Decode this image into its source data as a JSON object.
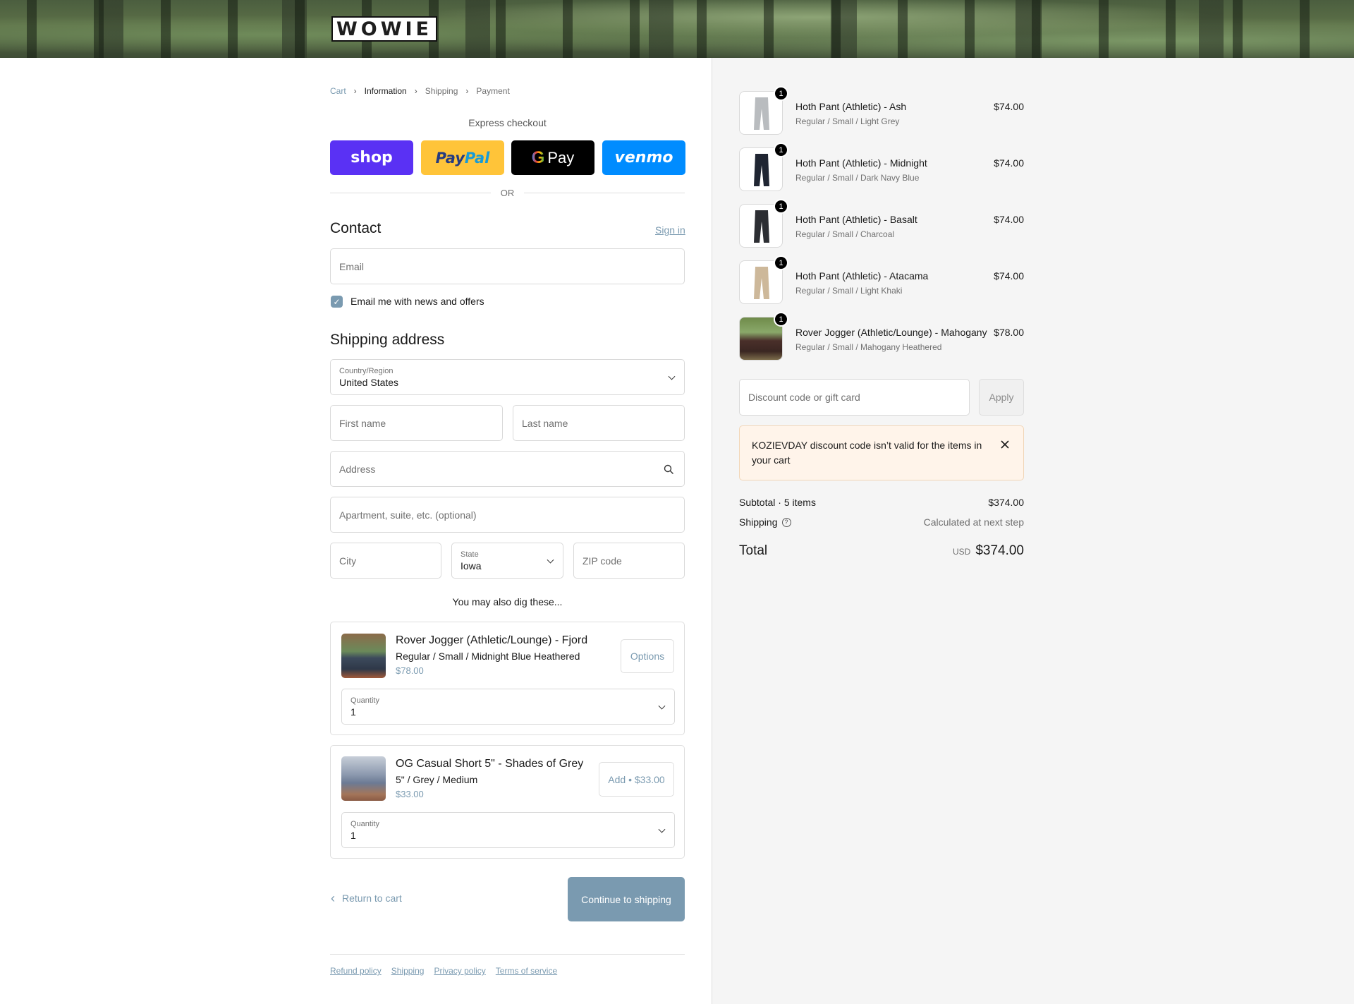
{
  "brand": {
    "logo_text": "WOWIE"
  },
  "breadcrumb": {
    "items": [
      "Cart",
      "Information",
      "Shipping",
      "Payment"
    ],
    "active_index": 1
  },
  "express": {
    "title": "Express checkout",
    "shop_label": "shop",
    "paypal_part1": "Pay",
    "paypal_part2": "Pal",
    "gpay_g": "G",
    "gpay_label": "Pay",
    "venmo_label": "venmo",
    "or_label": "OR"
  },
  "contact": {
    "heading": "Contact",
    "sign_in_label": "Sign in",
    "email_placeholder": "Email",
    "newsletter_label": "Email me with news and offers",
    "newsletter_checked": true
  },
  "shipping_address": {
    "heading": "Shipping address",
    "country_label": "Country/Region",
    "country_value": "United States",
    "first_name_placeholder": "First name",
    "last_name_placeholder": "Last name",
    "address_placeholder": "Address",
    "apartment_placeholder": "Apartment, suite, etc. (optional)",
    "city_placeholder": "City",
    "state_label": "State",
    "state_value": "Iowa",
    "zip_placeholder": "ZIP code"
  },
  "upsell": {
    "heading": "You may also dig these...",
    "items": [
      {
        "name": "Rover Jogger (Athletic/Lounge) - Fjord",
        "variant": "Regular / Small / Midnight Blue Heathered",
        "price": "$78.00",
        "action_label": "Options",
        "quantity_label": "Quantity",
        "quantity_value": "1"
      },
      {
        "name": "OG Casual Short 5\" - Shades of Grey",
        "variant": "5\" / Grey / Medium",
        "price": "$33.00",
        "action_label": "Add • $33.00",
        "quantity_label": "Quantity",
        "quantity_value": "1"
      }
    ]
  },
  "nav": {
    "return_label": "Return to cart",
    "continue_label": "Continue to shipping"
  },
  "footer": {
    "links": [
      "Refund policy",
      "Shipping",
      "Privacy policy",
      "Terms of service"
    ]
  },
  "order": {
    "items": [
      {
        "name": "Hoth Pant (Athletic) - Ash",
        "variant": "Regular / Small / Light Grey",
        "price": "$74.00",
        "qty": "1",
        "color": "#b9bcbf"
      },
      {
        "name": "Hoth Pant (Athletic) - Midnight",
        "variant": "Regular / Small / Dark Navy Blue",
        "price": "$74.00",
        "qty": "1",
        "color": "#1f2532"
      },
      {
        "name": "Hoth Pant (Athletic) - Basalt",
        "variant": "Regular / Small / Charcoal",
        "price": "$74.00",
        "qty": "1",
        "color": "#2c2e33"
      },
      {
        "name": "Hoth Pant (Athletic) - Atacama",
        "variant": "Regular / Small / Light Khaki",
        "price": "$74.00",
        "qty": "1",
        "color": "#cdb89a"
      },
      {
        "name": "Rover Jogger (Athletic/Lounge) - Mahogany",
        "variant": "Regular / Small / Mahogany Heathered",
        "price": "$78.00",
        "qty": "1",
        "color": "#4a2f2a"
      }
    ],
    "discount_placeholder": "Discount code or gift card",
    "apply_label": "Apply",
    "notice_text": "KOZIEVDAY discount code isn’t valid for the items in your cart",
    "subtotal_label": "Subtotal · 5 items",
    "subtotal_value": "$374.00",
    "shipping_label": "Shipping",
    "shipping_value": "Calculated at next step",
    "total_label": "Total",
    "currency": "USD",
    "total_value": "$374.00"
  },
  "colors": {
    "accent": "#7a9ab0",
    "shop": "#5a31f4",
    "paypal": "#ffc439",
    "venmo": "#008cff",
    "notice_bg": "#fff4ea"
  }
}
